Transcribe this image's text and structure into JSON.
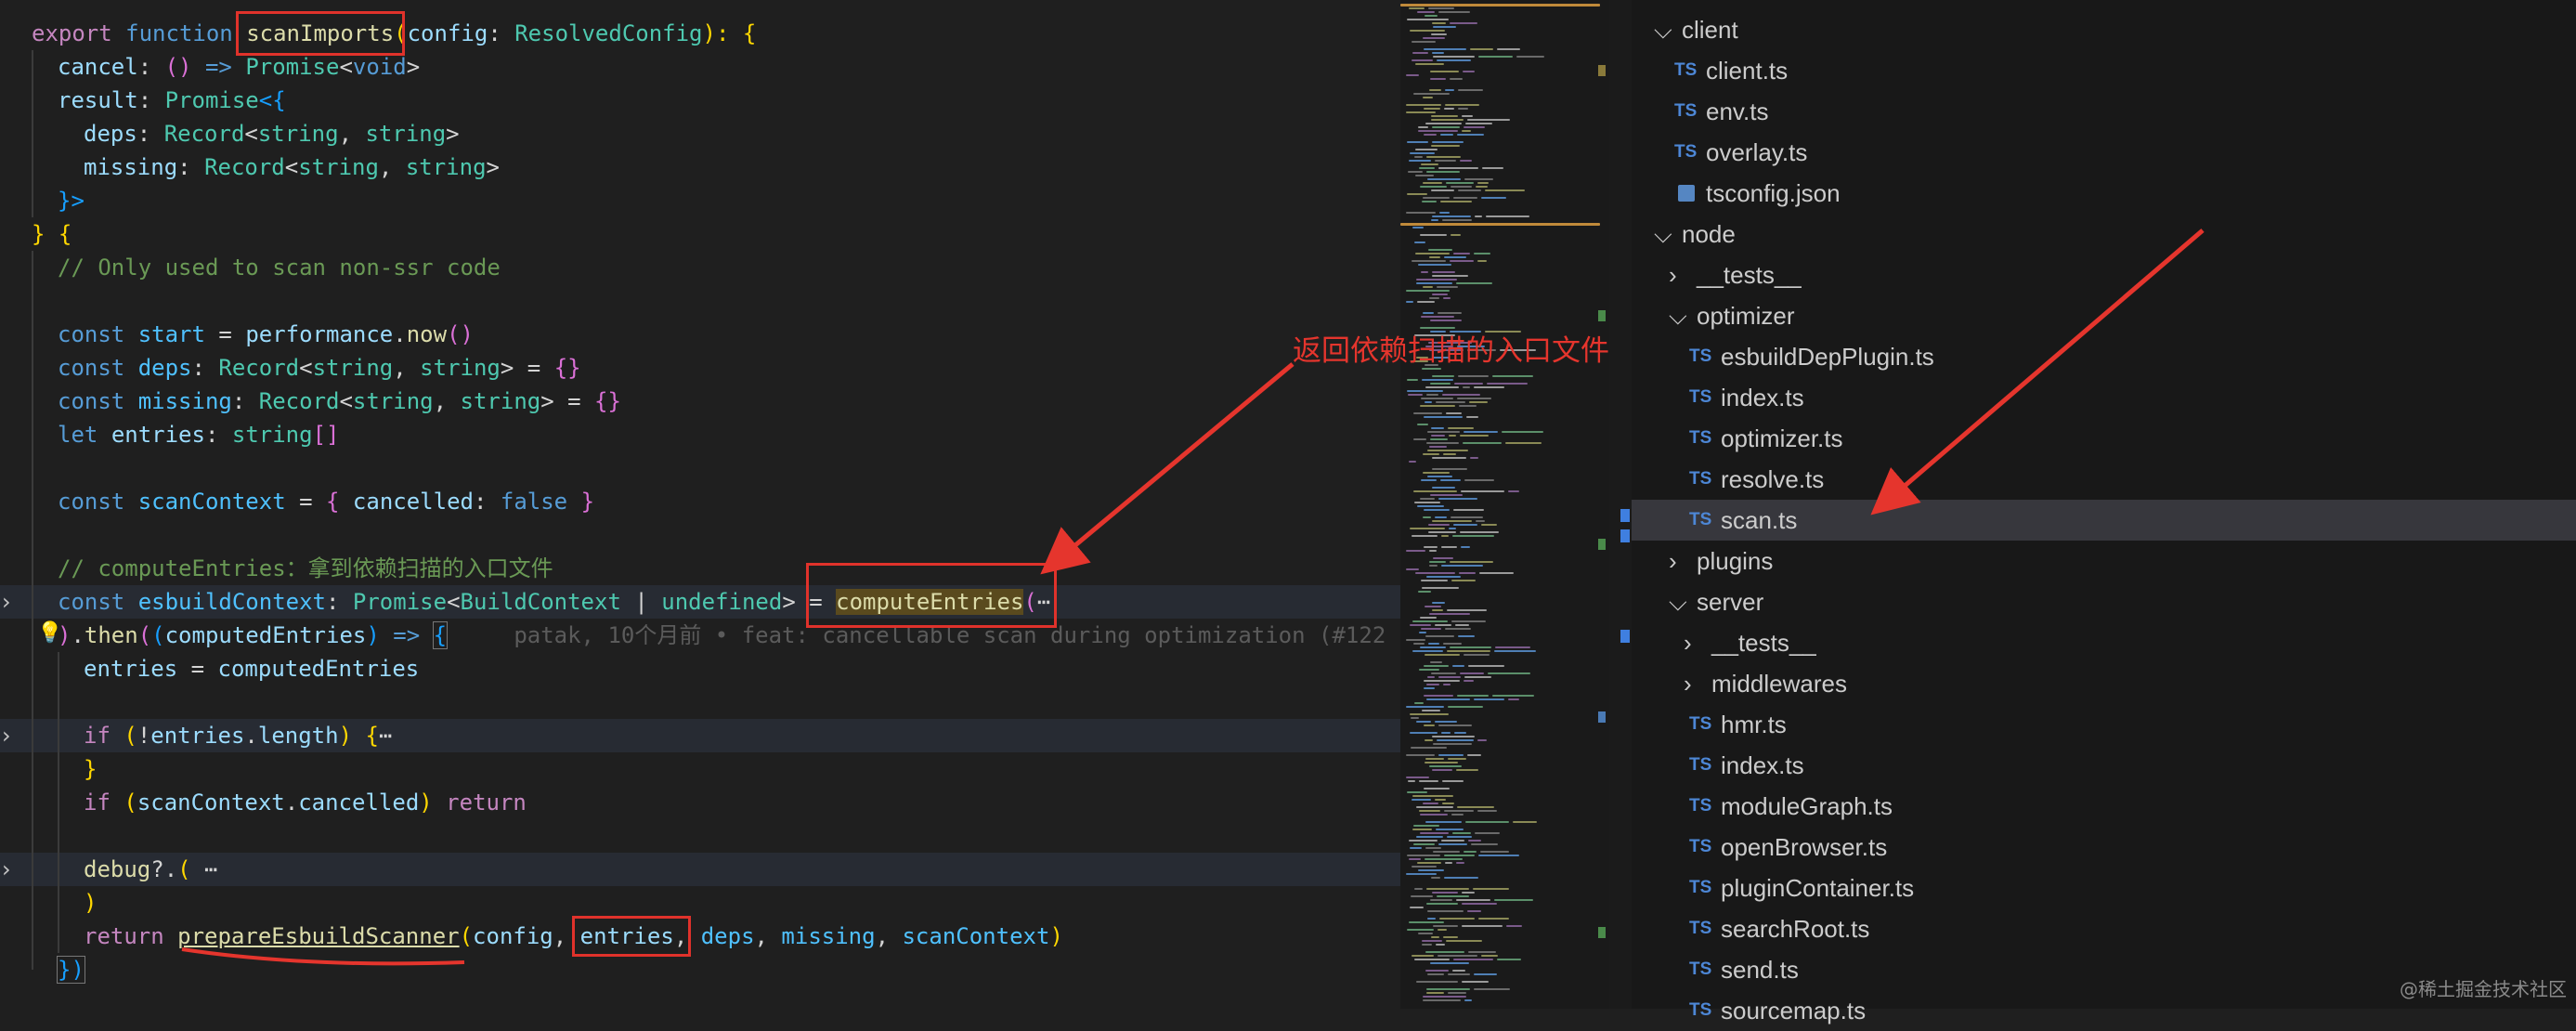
{
  "code": {
    "l1": {
      "a": "export",
      "b": "function",
      "c": "scanImports",
      "d": "(",
      "e": "config",
      "f": ": ",
      "g": "ResolvedConfig",
      "h": "): ",
      "i": "{"
    },
    "l2": {
      "a": "cancel",
      "b": ": ",
      "c": "()",
      "d": " => ",
      "e": "Promise",
      "f": "<",
      "g": "void",
      "h": ">"
    },
    "l3": {
      "a": "result",
      "b": ": ",
      "c": "Promise",
      "d": "<{"
    },
    "l4": {
      "a": "deps",
      "b": ": ",
      "c": "Record",
      "d": "<",
      "e": "string",
      "f": ", ",
      "g": "string",
      "h": ">"
    },
    "l5": {
      "a": "missing",
      "b": ": ",
      "c": "Record",
      "d": "<",
      "e": "string",
      "f": ", ",
      "g": "string",
      "h": ">"
    },
    "l6": {
      "a": "}>"
    },
    "l7": {
      "a": "}",
      "b": " {"
    },
    "l8": {
      "a": "// Only used to scan non-ssr code"
    },
    "l10": {
      "a": "const",
      "b": "start",
      "c": " = ",
      "d": "performance",
      "e": ".",
      "f": "now",
      "g": "()"
    },
    "l11": {
      "a": "const",
      "b": "deps",
      "c": ": ",
      "d": "Record",
      "e": "<",
      "f": "string",
      "g": ", ",
      "h": "string",
      "i": ">",
      "j": " = ",
      "k": "{}"
    },
    "l12": {
      "a": "const",
      "b": "missing",
      "c": ": ",
      "d": "Record",
      "e": "<",
      "f": "string",
      "g": ", ",
      "h": "string",
      "i": ">",
      "j": " = ",
      "k": "{}"
    },
    "l13": {
      "a": "let",
      "b": "entries",
      "c": ": ",
      "d": "string",
      "e": "[]"
    },
    "l15": {
      "a": "const",
      "b": "scanContext",
      "c": " = ",
      "d": "{",
      "e": " cancelled",
      "f": ": ",
      "g": "false",
      "h": " }"
    },
    "l17": {
      "a": "// computeEntries：拿到依赖扫描的入口文件"
    },
    "l18": {
      "a": "const",
      "b": "esbuildContext",
      "c": ": ",
      "d": "Promise",
      "e": "<",
      "f": "BuildContext",
      "g": " | ",
      "h": "undefined",
      "i": ">",
      "j": " = ",
      "k": "computeEntries",
      "l": "(",
      "m": "⋯"
    },
    "l19": {
      "a": ")",
      "b": ".",
      "c": "then",
      "d": "(",
      "e": "(",
      "f": "computedEntries",
      "g": ")",
      "h": " => ",
      "i": "{",
      "blame": "patak, 10个月前 • feat: cancellable scan during optimization (#122"
    },
    "l20": {
      "a": "entries",
      "b": " = ",
      "c": "computedEntries"
    },
    "l22": {
      "a": "if",
      "b": " (",
      "c": "!",
      "d": "entries",
      "e": ".",
      "f": "length",
      "g": ") ",
      "h": "{",
      "i": "⋯"
    },
    "l23": {
      "a": "}"
    },
    "l24": {
      "a": "if",
      "b": " (",
      "c": "scanContext",
      "d": ".",
      "e": "cancelled",
      "f": ") ",
      "g": "return"
    },
    "l26": {
      "a": "debug",
      "b": "?.",
      "c": "(",
      "d": " ⋯"
    },
    "l27": {
      "a": ")"
    },
    "l28": {
      "a": "return",
      "b": "prepareEsbuildScanner",
      "c": "(",
      "d": "config",
      "e": ", ",
      "f": "entries",
      "g": ", ",
      "h": "deps",
      "i": ", ",
      "j": "missing",
      "k": ", ",
      "l": "scanContext",
      "m": ")"
    },
    "l29": {
      "a": "})"
    }
  },
  "explorer": {
    "items": [
      {
        "label": "client",
        "kind": "folder-open"
      },
      {
        "label": "client.ts",
        "kind": "ts"
      },
      {
        "label": "env.ts",
        "kind": "ts"
      },
      {
        "label": "overlay.ts",
        "kind": "ts"
      },
      {
        "label": "tsconfig.json",
        "kind": "json"
      },
      {
        "label": "node",
        "kind": "folder-open"
      },
      {
        "label": "__tests__",
        "kind": "folder-closed"
      },
      {
        "label": "optimizer",
        "kind": "folder-open"
      },
      {
        "label": "esbuildDepPlugin.ts",
        "kind": "ts"
      },
      {
        "label": "index.ts",
        "kind": "ts"
      },
      {
        "label": "optimizer.ts",
        "kind": "ts"
      },
      {
        "label": "resolve.ts",
        "kind": "ts"
      },
      {
        "label": "scan.ts",
        "kind": "ts"
      },
      {
        "label": "plugins",
        "kind": "folder-closed"
      },
      {
        "label": "server",
        "kind": "folder-open"
      },
      {
        "label": "__tests__",
        "kind": "folder-closed"
      },
      {
        "label": "middlewares",
        "kind": "folder-closed"
      },
      {
        "label": "hmr.ts",
        "kind": "ts"
      },
      {
        "label": "index.ts",
        "kind": "ts"
      },
      {
        "label": "moduleGraph.ts",
        "kind": "ts"
      },
      {
        "label": "openBrowser.ts",
        "kind": "ts"
      },
      {
        "label": "pluginContainer.ts",
        "kind": "ts"
      },
      {
        "label": "searchRoot.ts",
        "kind": "ts"
      },
      {
        "label": "send.ts",
        "kind": "ts"
      },
      {
        "label": "sourcemap.ts",
        "kind": "ts"
      }
    ],
    "ts_badge": "TS",
    "chevron_open": "⌵",
    "chevron_closed": "›",
    "selected_label": "scan.ts"
  },
  "annotation": {
    "text": "返回依赖扫描的入口文件"
  },
  "watermark": {
    "text": "@稀土掘金技术社区"
  },
  "colors": {
    "annotation": "#e5352d",
    "keyword": "#569cd6",
    "function": "#dcdcaa",
    "type": "#4ec9b0",
    "variable": "#9cdcfe",
    "comment": "#6a9955"
  }
}
